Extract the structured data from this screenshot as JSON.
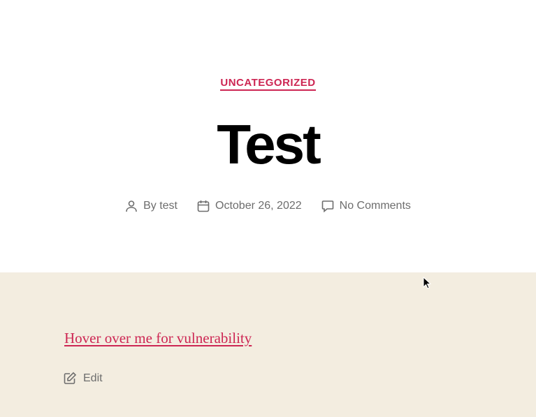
{
  "post": {
    "category": "UNCATEGORIZED",
    "title": "Test",
    "meta": {
      "author": "By test",
      "date": "October 26, 2022",
      "comments": "No Comments"
    },
    "content_link": "Hover over me for vulnerability",
    "edit_label": "Edit"
  },
  "colors": {
    "accent": "#cd2653",
    "content_bg": "#f3ede0",
    "meta_text": "#6d6d6d"
  }
}
